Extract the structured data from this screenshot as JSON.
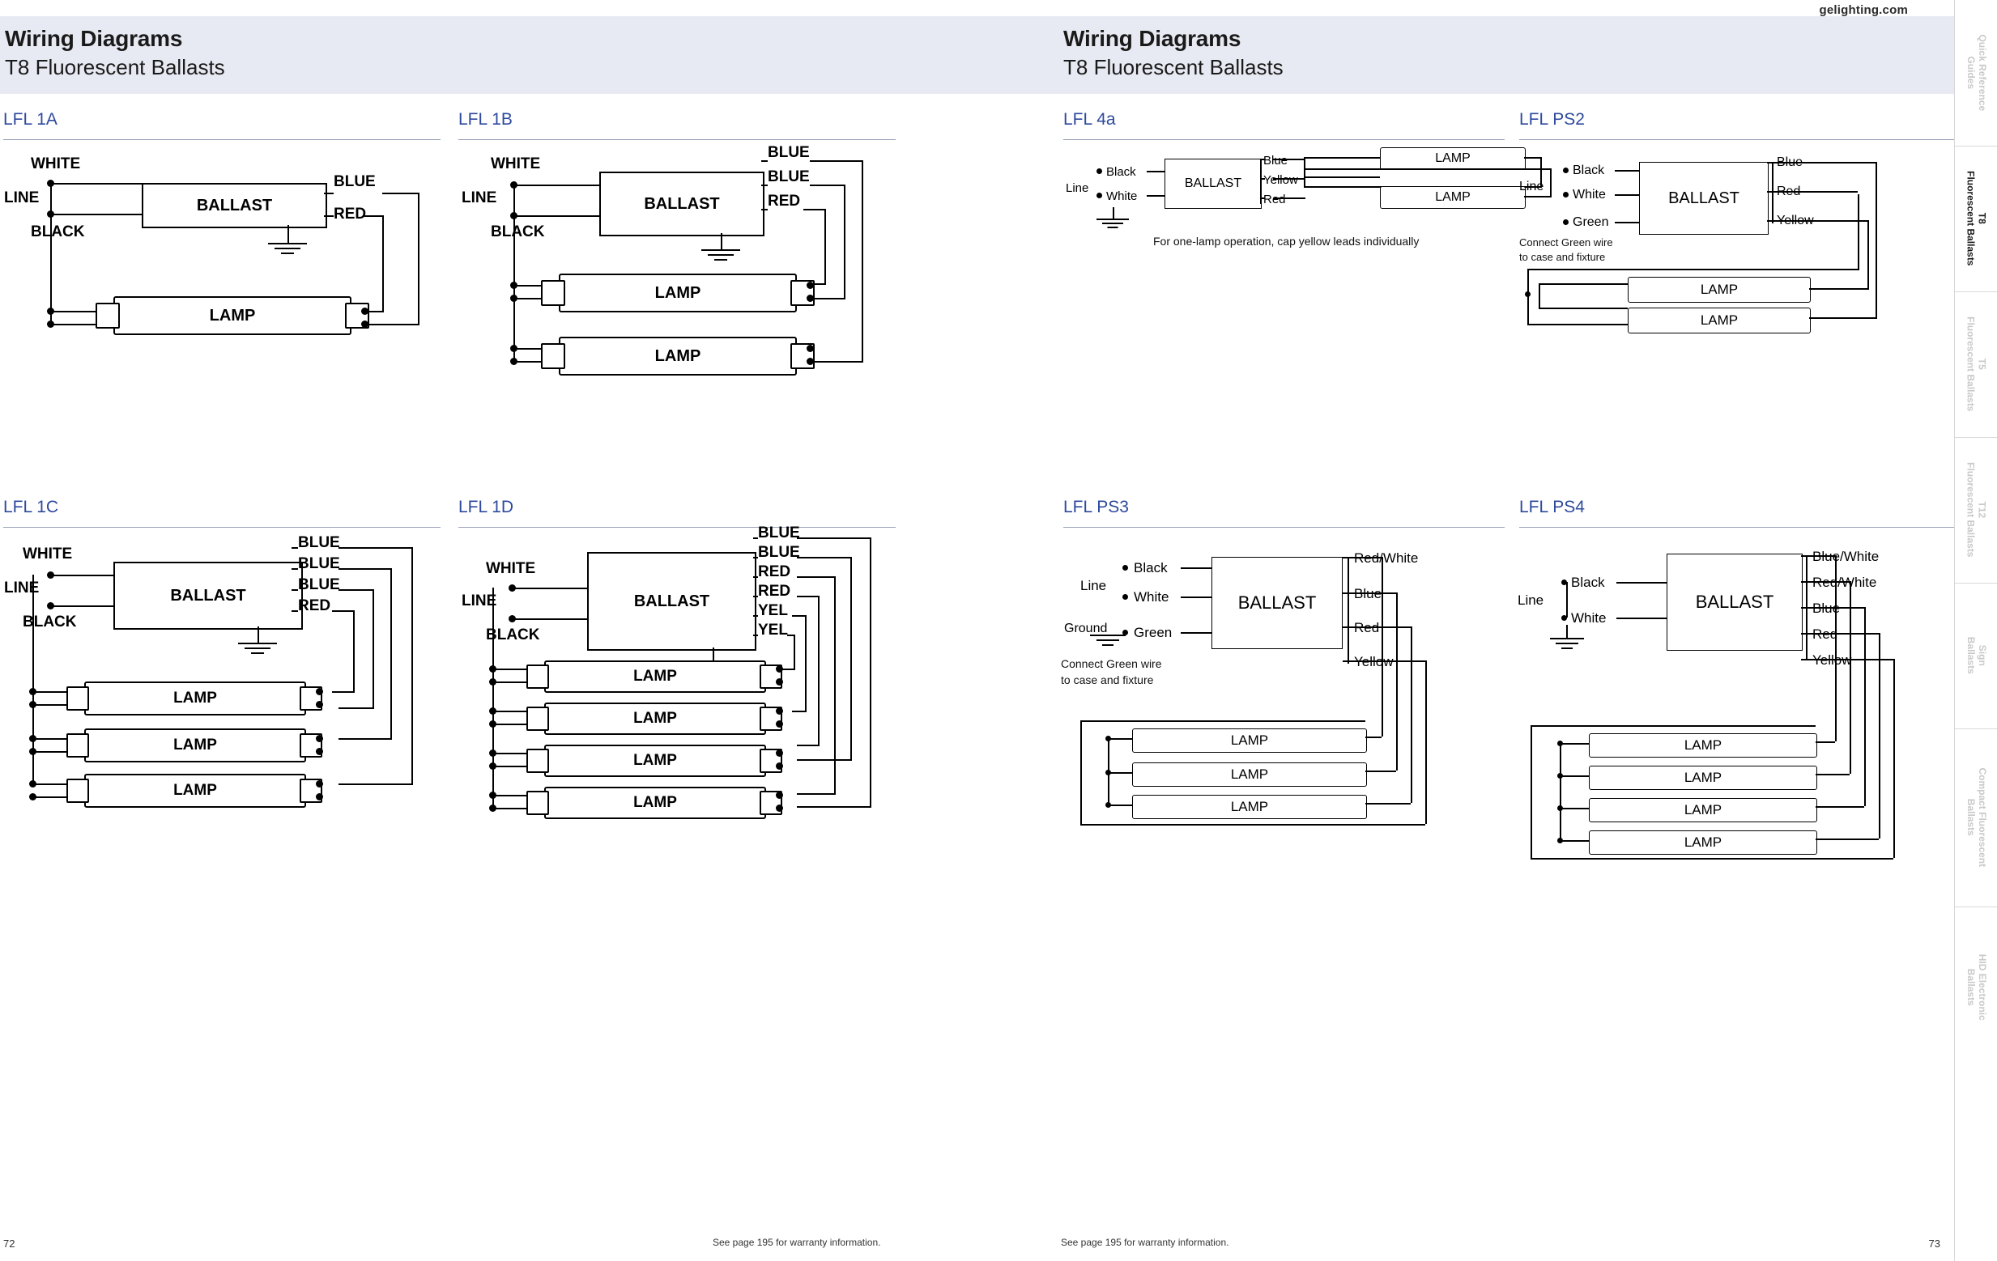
{
  "site_url": "gelighting.com",
  "left_page": {
    "header": {
      "title": "Wiring Diagrams",
      "subtitle": "T8 Fluorescent Ballasts"
    },
    "page_number": "72",
    "footer_note": "See page 195 for warranty information.",
    "diagrams": [
      {
        "code": "LFL 1A",
        "ballast_label": "BALLAST",
        "left_labels": [
          "WHITE",
          "LINE",
          "BLACK"
        ],
        "right_labels": [
          "BLUE",
          "RED"
        ],
        "lamps": [
          "LAMP"
        ]
      },
      {
        "code": "LFL 1B",
        "ballast_label": "BALLAST",
        "left_labels": [
          "WHITE",
          "LINE",
          "BLACK"
        ],
        "right_labels": [
          "BLUE",
          "BLUE",
          "RED"
        ],
        "lamps": [
          "LAMP",
          "LAMP"
        ]
      },
      {
        "code": "LFL 1C",
        "ballast_label": "BALLAST",
        "left_labels": [
          "WHITE",
          "LINE",
          "BLACK"
        ],
        "right_labels": [
          "BLUE",
          "BLUE",
          "BLUE",
          "RED"
        ],
        "lamps": [
          "LAMP",
          "LAMP",
          "LAMP"
        ]
      },
      {
        "code": "LFL 1D",
        "ballast_label": "BALLAST",
        "left_labels": [
          "WHITE",
          "LINE",
          "BLACK"
        ],
        "right_labels": [
          "BLUE",
          "BLUE",
          "RED",
          "RED",
          "YEL",
          "YEL"
        ],
        "lamps": [
          "LAMP",
          "LAMP",
          "LAMP",
          "LAMP"
        ]
      }
    ]
  },
  "right_page": {
    "header": {
      "title": "Wiring Diagrams",
      "subtitle": "T8 Fluorescent Ballasts"
    },
    "page_number": "73",
    "footer_note": "See page 195 for warranty information.",
    "diagrams": [
      {
        "code": "LFL 4a",
        "ballast_label": "BALLAST",
        "line_label": "Line",
        "left_labels": [
          "Black",
          "White"
        ],
        "right_labels": [
          "Blue",
          "Yellow",
          "Red"
        ],
        "lamps": [
          "LAMP",
          "LAMP"
        ],
        "note": "For one-lamp operation, cap yellow leads individually"
      },
      {
        "code": "LFL PS2",
        "ballast_label": "BALLAST",
        "line_label": "Line",
        "left_labels": [
          "Black",
          "White",
          "Green"
        ],
        "right_labels": [
          "Blue",
          "Red",
          "Yellow"
        ],
        "lamps": [
          "LAMP",
          "LAMP"
        ],
        "note": "Connect Green wire\nto case and fixture",
        "note_line1": "Connect Green wire",
        "note_line2": "to case and fixture"
      },
      {
        "code": "LFL PS3",
        "ballast_label": "BALLAST",
        "line_label": "Line",
        "ground_label": "Ground",
        "left_labels": [
          "Black",
          "White",
          "Green"
        ],
        "right_labels": [
          "Red/White",
          "Blue",
          "Red",
          "Yellow"
        ],
        "lamps": [
          "LAMP",
          "LAMP",
          "LAMP"
        ],
        "note_line1": "Connect Green wire",
        "note_line2": "to case and fixture"
      },
      {
        "code": "LFL PS4",
        "ballast_label": "BALLAST",
        "line_label": "Line",
        "left_labels": [
          "Black",
          "White"
        ],
        "right_labels": [
          "Blue/White",
          "Red/White",
          "Blue",
          "Red",
          "Yellow"
        ],
        "lamps": [
          "LAMP",
          "LAMP",
          "LAMP",
          "LAMP"
        ]
      }
    ]
  },
  "side_rail": {
    "tabs": [
      {
        "line1": "Quick Reference",
        "line2": "Guides",
        "state": "dim"
      },
      {
        "line1": "T8",
        "line2": "Fluorescent Ballasts",
        "state": "active"
      },
      {
        "line1": "T5",
        "line2": "Fluorescent Ballasts",
        "state": "dim"
      },
      {
        "line1": "T12",
        "line2": "Fluorescent Ballasts",
        "state": "dim"
      },
      {
        "line1": "Sign",
        "line2": "Ballasts",
        "state": "dim"
      },
      {
        "line1": "Compact Fluorescent",
        "line2": "Ballasts",
        "state": "dim"
      },
      {
        "line1": "HID Electronic",
        "line2": "Ballasts",
        "state": "dim"
      }
    ]
  },
  "colors": {
    "band": "#e8eaf3",
    "accent": "#2e4a9e",
    "rule": "#9aa2b8"
  }
}
